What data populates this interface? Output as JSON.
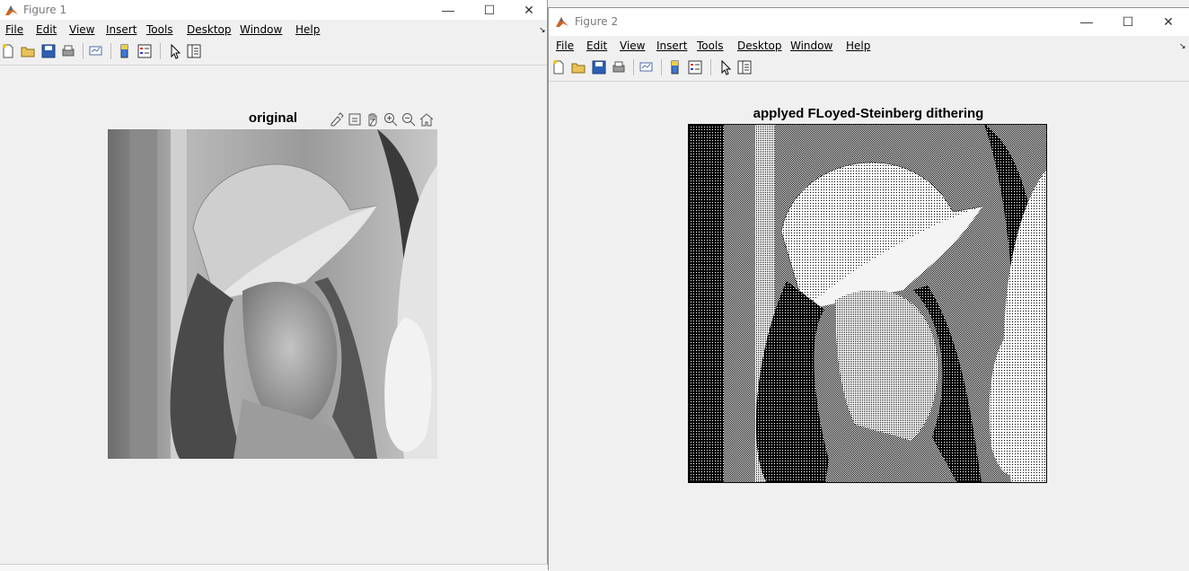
{
  "figure1": {
    "title": "Figure 1",
    "menu": [
      "File",
      "Edit",
      "View",
      "Insert",
      "Tools",
      "Desktop",
      "Window",
      "Help"
    ],
    "axes_title": "original",
    "axes_toolbar": [
      "brush-icon",
      "datatip-icon",
      "pan-icon",
      "zoom-in-icon",
      "zoom-out-icon",
      "home-icon"
    ]
  },
  "figure2": {
    "title": "Figure 2",
    "menu": [
      "File",
      "Edit",
      "View",
      "Insert",
      "Tools",
      "Desktop",
      "Window",
      "Help"
    ],
    "axes_title": "applyed FLoyed-Steinberg dithering"
  },
  "toolbar_icons": [
    "new-figure-icon",
    "open-icon",
    "save-icon",
    "print-icon",
    "link-plot-icon",
    "colorbar-icon",
    "legend-icon",
    "pointer-icon",
    "property-inspector-icon"
  ],
  "window_controls": [
    "minimize-icon",
    "maximize-icon",
    "close-icon"
  ],
  "glyphs": {
    "minimize": "—",
    "maximize": "☐",
    "close": "✕",
    "corner": "↘"
  },
  "colors": {
    "background": "#f0f0f0",
    "titlebar": "#ffffff",
    "title_text": "#7a7a7a"
  }
}
